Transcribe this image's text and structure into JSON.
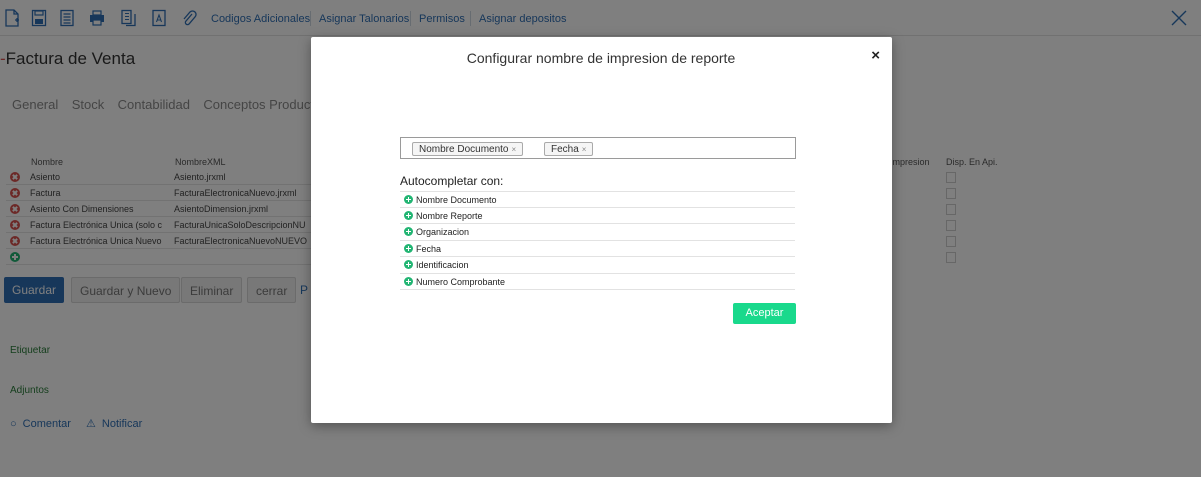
{
  "colors": {
    "brand_blue": "#2f6fb5",
    "accent_green": "#19d98c",
    "danger_red": "#d9534f",
    "add_green": "#22b573"
  },
  "toolbar": {
    "icons": [
      "new-document-icon",
      "save-icon",
      "list-document-icon",
      "print-icon",
      "report-icon",
      "pdf-icon",
      "attach-icon"
    ],
    "links": [
      "Codigos Adicionales",
      "Asignar Talonarios",
      "Permisos",
      "Asignar depositos"
    ],
    "close_icon": "close-icon"
  },
  "page": {
    "title": "Factura de Venta",
    "tabs": [
      "General",
      "Stock",
      "Contabilidad",
      "Conceptos Product"
    ]
  },
  "grid": {
    "columns": [
      "Nombre",
      "NombreXML"
    ],
    "right_columns": [
      "e impresion",
      "Disp. En Api."
    ],
    "rows": [
      {
        "nombre": "Asiento",
        "xml": "Asiento.jrxml"
      },
      {
        "nombre": "Factura",
        "xml": "FacturaElectronicaNuevo.jrxml"
      },
      {
        "nombre": "Asiento Con Dimensiones",
        "xml": "AsientoDimension.jrxml"
      },
      {
        "nombre": "Factura Electrónica Unica (solo c",
        "xml": "FacturaUnicaSoloDescripcionNU"
      },
      {
        "nombre": "Factura Electrónica Unica Nuevo",
        "xml": "FacturaElectronicaNuevoNUEVO"
      }
    ]
  },
  "buttons": {
    "save": "Guardar",
    "save_new": "Guardar y Nuevo",
    "delete": "Eliminar",
    "close": "cerrar",
    "extra": "P"
  },
  "links": {
    "tag": "Etiquetar",
    "attachments": "Adjuntos",
    "comment": "Comentar",
    "notify": "Notificar"
  },
  "modal": {
    "title": "Configurar nombre de impresion de reporte",
    "close": "×",
    "selected_tags": [
      "Nombre Documento",
      "Fecha"
    ],
    "tag_remove": "×",
    "autocomplete_title": "Autocompletar con:",
    "autocomplete_items": [
      "Nombre Documento",
      "Nombre Reporte",
      "Organizacion",
      "Fecha",
      "Identificacion",
      "Numero Comprobante"
    ],
    "accept": "Aceptar"
  }
}
